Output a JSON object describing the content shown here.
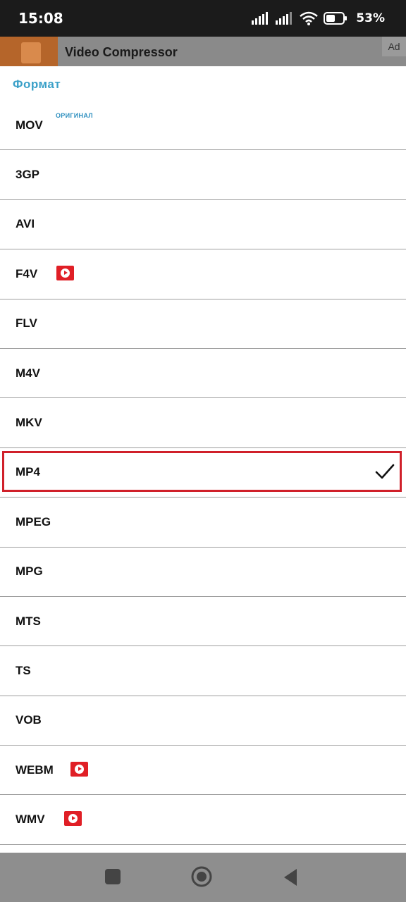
{
  "status_bar": {
    "time": "15:08",
    "battery_percent": "53%"
  },
  "ad": {
    "title": "Video Compressor",
    "badge": "Ad"
  },
  "sheet": {
    "title": "Формат",
    "items": [
      {
        "label": "MOV",
        "badge": "ОРИГИНАЛ",
        "premium": false,
        "selected": false
      },
      {
        "label": "3GP",
        "premium": false,
        "selected": false
      },
      {
        "label": "AVI",
        "premium": false,
        "selected": false
      },
      {
        "label": "F4V",
        "premium": true,
        "selected": false
      },
      {
        "label": "FLV",
        "premium": false,
        "selected": false
      },
      {
        "label": "M4V",
        "premium": false,
        "selected": false
      },
      {
        "label": "MKV",
        "premium": false,
        "selected": false
      },
      {
        "label": "MP4",
        "premium": false,
        "selected": true
      },
      {
        "label": "MPEG",
        "premium": false,
        "selected": false
      },
      {
        "label": "MPG",
        "premium": false,
        "selected": false
      },
      {
        "label": "MTS",
        "premium": false,
        "selected": false
      },
      {
        "label": "TS",
        "premium": false,
        "selected": false
      },
      {
        "label": "VOB",
        "premium": false,
        "selected": false
      },
      {
        "label": "WEBM",
        "premium": true,
        "selected": false
      },
      {
        "label": "WMV",
        "premium": true,
        "selected": false
      }
    ]
  },
  "colors": {
    "accent_title": "#3aa0c8",
    "selection_border": "#d0202a",
    "premium_icon": "#e01f26"
  },
  "icons": {
    "premium": "play-badge-icon",
    "selected": "checkmark-icon"
  }
}
